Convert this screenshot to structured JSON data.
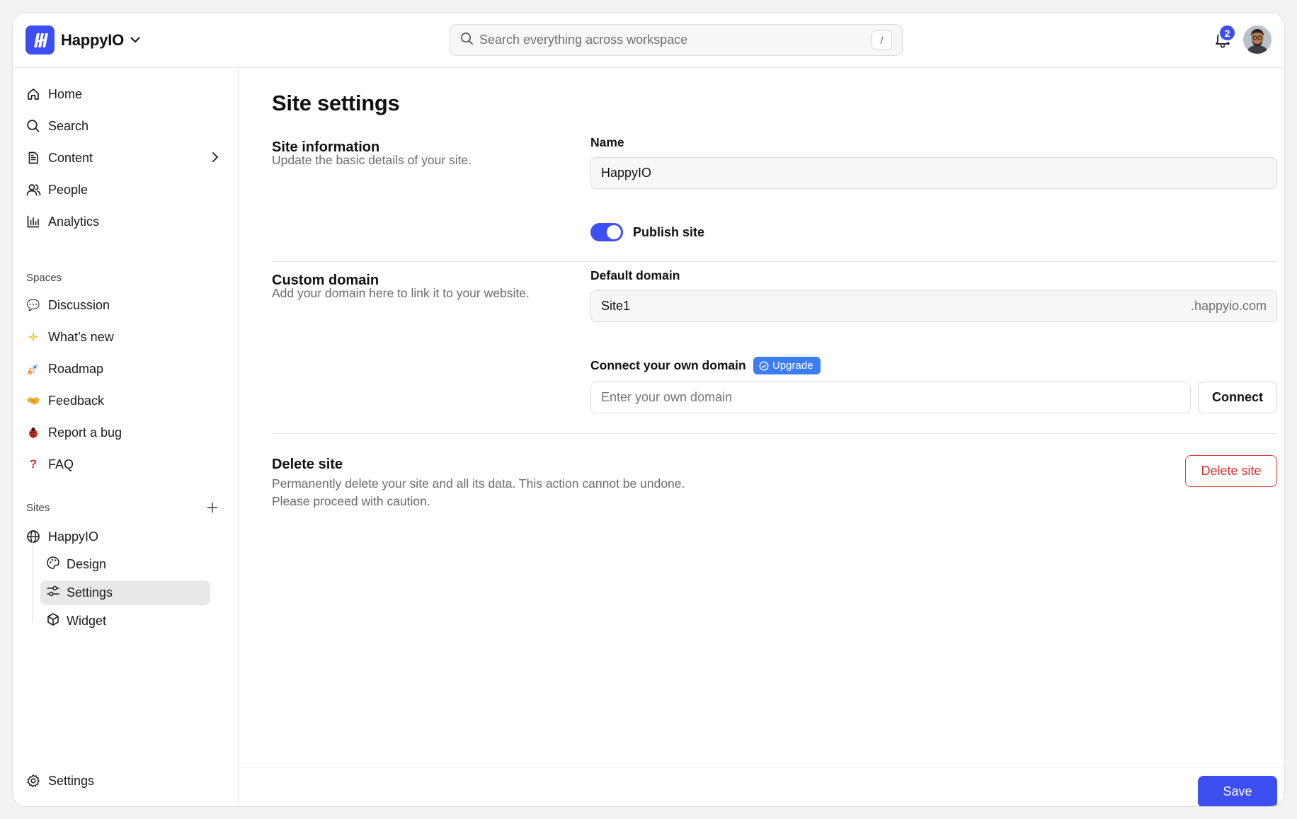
{
  "app": {
    "name": "HappyIO",
    "brand_color": "#3d4ef3"
  },
  "header": {
    "search_placeholder": "Search everything across workspace",
    "search_shortcut": "/",
    "notification_count": "2"
  },
  "sidebar": {
    "nav": [
      {
        "label": "Home",
        "icon": "home-icon"
      },
      {
        "label": "Search",
        "icon": "search-icon"
      },
      {
        "label": "Content",
        "icon": "document-icon"
      },
      {
        "label": "People",
        "icon": "people-icon"
      },
      {
        "label": "Analytics",
        "icon": "bar-chart-icon"
      }
    ],
    "spaces_label": "Spaces",
    "spaces": [
      {
        "label": "Discussion",
        "icon": "speech-bubble-emoji"
      },
      {
        "label": "What’s new",
        "icon": "sparkle-emoji"
      },
      {
        "label": "Roadmap",
        "icon": "rocket-emoji"
      },
      {
        "label": "Feedback",
        "icon": "handshake-emoji"
      },
      {
        "label": "Report a bug",
        "icon": "ladybug-emoji"
      },
      {
        "label": "FAQ",
        "icon": "question-mark-emoji"
      }
    ],
    "sites_label": "Sites",
    "site": {
      "label": "HappyIO",
      "icon": "globe-icon"
    },
    "site_children": [
      {
        "label": "Design",
        "icon": "palette-icon"
      },
      {
        "label": "Settings",
        "icon": "sliders-icon",
        "active": true
      },
      {
        "label": "Widget",
        "icon": "cube-icon"
      }
    ],
    "settings_label": "Settings"
  },
  "main": {
    "title": "Site settings",
    "site_info": {
      "title": "Site information",
      "description": "Update the basic details of your site.",
      "name_label": "Name",
      "name_value": "HappyIO",
      "publish_label": "Publish site",
      "publish_on": true
    },
    "custom_domain": {
      "title": "Custom domain",
      "description": "Add your domain here to link it to your website.",
      "default_domain_label": "Default domain",
      "default_domain_value": "Site1",
      "default_domain_suffix": ".happyio.com",
      "own_domain_label": "Connect your own domain",
      "upgrade_label": "Upgrade",
      "own_domain_placeholder": "Enter your own domain",
      "connect_label": "Connect"
    },
    "delete_site": {
      "title": "Delete site",
      "description_line1": "Permanently delete your site and all its data. This action cannot be undone.",
      "description_line2": "Please proceed with caution.",
      "button_label": "Delete site"
    },
    "save_label": "Save"
  }
}
